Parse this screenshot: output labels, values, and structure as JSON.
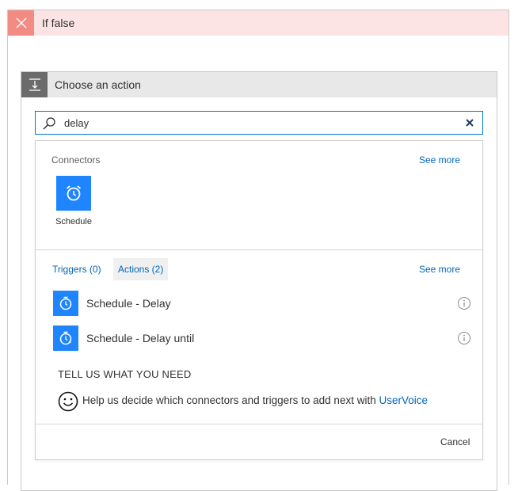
{
  "if_false": {
    "title": "If false"
  },
  "action_card": {
    "title": "Choose an action"
  },
  "search": {
    "value": "delay",
    "placeholder": ""
  },
  "connectors": {
    "heading": "Connectors",
    "see_more": "See more",
    "items": [
      {
        "label": "Schedule",
        "icon": "alarm-clock-icon"
      }
    ]
  },
  "tabs": {
    "triggers": "Triggers (0)",
    "actions": "Actions (2)",
    "see_more": "See more"
  },
  "actions": [
    {
      "label": "Schedule - Delay",
      "icon": "timer-icon"
    },
    {
      "label": "Schedule - Delay until",
      "icon": "timer-until-icon"
    }
  ],
  "feedback": {
    "heading": "TELL US WHAT YOU NEED",
    "text": "Help us decide which connectors and triggers to add next with ",
    "link": "UserVoice"
  },
  "footer": {
    "cancel": "Cancel"
  },
  "colors": {
    "accent": "#1f85ff",
    "link": "#0066b8",
    "if_false_bg": "#fce4e4",
    "if_false_icon_bg": "#f28b82"
  }
}
